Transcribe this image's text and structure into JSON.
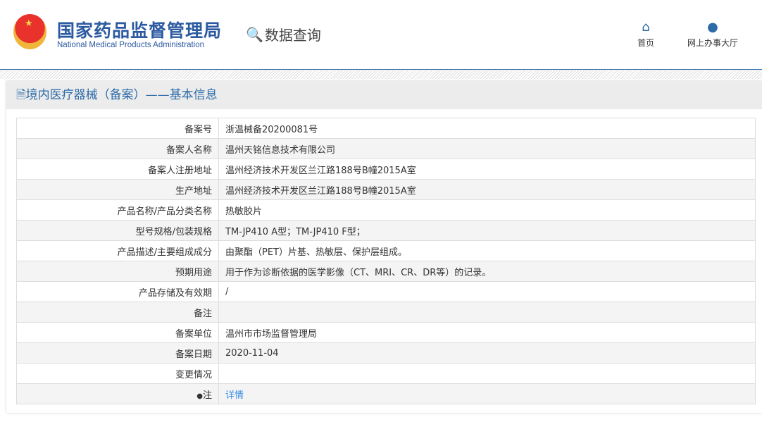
{
  "header": {
    "logo_cn": "国家药品监督管理局",
    "logo_en": "National Medical Products Administration",
    "section": "数据查询",
    "nav": [
      {
        "label": "首页",
        "icon": "home-icon"
      },
      {
        "label": "网上办事大厅",
        "icon": "user-icon"
      }
    ]
  },
  "panel": {
    "title": "境内医疗器械（备案）——基本信息"
  },
  "rows": [
    {
      "label": "备案号",
      "value": "浙温械备20200081号"
    },
    {
      "label": "备案人名称",
      "value": "温州天铭信息技术有限公司"
    },
    {
      "label": "备案人注册地址",
      "value": "温州经济技术开发区兰江路188号B幢2015A室"
    },
    {
      "label": "生产地址",
      "value": "温州经济技术开发区兰江路188号B幢2015A室"
    },
    {
      "label": "产品名称/产品分类名称",
      "value": "热敏胶片"
    },
    {
      "label": "型号规格/包装规格",
      "value": "TM-JP410 A型；TM-JP410 F型；"
    },
    {
      "label": "产品描述/主要组成成分",
      "value": "由聚酯（PET）片基、热敏层、保护层组成。"
    },
    {
      "label": "预期用途",
      "value": "用于作为诊断依据的医学影像（CT、MRI、CR、DR等）的记录。"
    },
    {
      "label": "产品存储及有效期",
      "value": "/"
    },
    {
      "label": "备注",
      "value": ""
    },
    {
      "label": "备案单位",
      "value": "温州市市场监督管理局"
    },
    {
      "label": "备案日期",
      "value": "2020-11-04"
    },
    {
      "label": "变更情况",
      "value": ""
    }
  ],
  "note": {
    "label": "注",
    "link": "详情"
  }
}
